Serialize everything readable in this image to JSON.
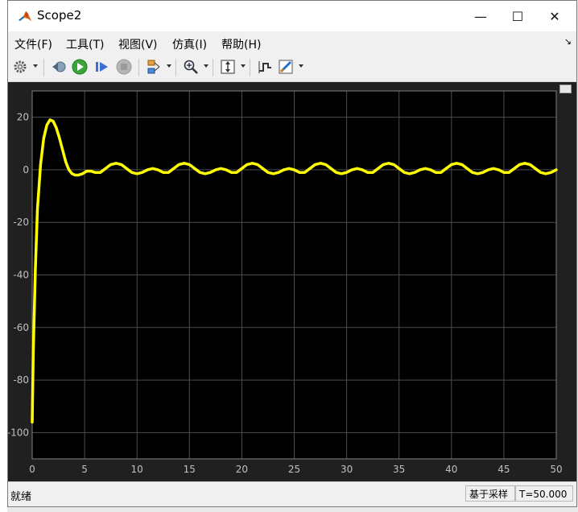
{
  "window": {
    "title": "Scope2",
    "minimize_symbol": "—",
    "maximize_symbol": "☐",
    "close_symbol": "✕"
  },
  "menu": {
    "items": [
      "文件(F)",
      "工具(T)",
      "视图(V)",
      "仿真(I)",
      "帮助(H)"
    ],
    "overflow_symbol": "↘"
  },
  "toolbar": {
    "buttons": [
      {
        "icon": "settings-gear-icon"
      },
      {
        "icon": "step-back-icon"
      },
      {
        "icon": "run-icon"
      },
      {
        "icon": "step-forward-icon"
      },
      {
        "icon": "stop-icon"
      },
      {
        "icon": "signal-selector-icon"
      },
      {
        "icon": "zoom-icon"
      },
      {
        "icon": "scale-axes-icon"
      },
      {
        "icon": "cursor-measure-icon"
      },
      {
        "icon": "style-icon"
      }
    ]
  },
  "status": {
    "left": "就绪",
    "mode": "基于采样",
    "time": "T=50.000"
  },
  "colors": {
    "plot_background": "#000000",
    "figure_background": "#202020",
    "grid": "#4d4d4d",
    "trace": "#ffff00",
    "tick_label": "#c0c0c0"
  },
  "chart_data": {
    "type": "line",
    "title": "",
    "xlabel": "",
    "ylabel": "",
    "xlim": [
      0,
      50
    ],
    "ylim": [
      -110,
      30
    ],
    "grid": true,
    "xticks": [
      0,
      5,
      10,
      15,
      20,
      25,
      30,
      35,
      40,
      45,
      50
    ],
    "yticks": [
      20,
      0,
      -20,
      -40,
      -60,
      -80,
      -100
    ],
    "series": [
      {
        "x": [
          0,
          0.1,
          0.3,
          0.5,
          0.8,
          1.1,
          1.4,
          1.7,
          2.0,
          2.3,
          2.6,
          2.9,
          3.2,
          3.5,
          3.8,
          4.1,
          4.4,
          4.8,
          5.2,
          5.6,
          6.0,
          6.5,
          7.0,
          7.5,
          8.0,
          8.5,
          9.0,
          9.5,
          10.0,
          10.5,
          11.0,
          11.5,
          12.0,
          12.5,
          13.0,
          13.5,
          14.0,
          14.5,
          15.0,
          15.5,
          16.0,
          16.5,
          17.0,
          17.5,
          18.0,
          18.5,
          19.0,
          19.5,
          20.0,
          20.5,
          21.0,
          21.5,
          22.0,
          22.5,
          23.0,
          23.5,
          24.0,
          24.5,
          25.0,
          25.5,
          26.0,
          26.5,
          27.0,
          27.5,
          28.0,
          28.5,
          29.0,
          29.5,
          30.0,
          30.5,
          31.0,
          31.5,
          32.0,
          32.5,
          33.0,
          33.5,
          34.0,
          34.5,
          35.0,
          35.5,
          36.0,
          36.5,
          37.0,
          37.5,
          38.0,
          38.5,
          39.0,
          39.5,
          40.0,
          40.5,
          41.0,
          41.5,
          42.0,
          42.5,
          43.0,
          43.5,
          44.0,
          44.5,
          45.0,
          45.5,
          46.0,
          46.5,
          47.0,
          47.5,
          48.0,
          48.5,
          49.0,
          49.5,
          50.0
        ],
        "y": [
          -96,
          -70,
          -38,
          -15,
          2,
          12,
          17,
          19,
          18.5,
          16,
          12,
          7.5,
          3,
          0,
          -1.5,
          -2,
          -2,
          -1.5,
          -0.5,
          -0.5,
          -1,
          -1,
          0.5,
          2,
          2.5,
          2,
          0.5,
          -1,
          -1.5,
          -1,
          0,
          0.5,
          0,
          -1,
          -1,
          0.5,
          2,
          2.5,
          2,
          0.5,
          -1,
          -1.5,
          -1,
          0,
          0.5,
          0,
          -1,
          -1,
          0.5,
          2,
          2.5,
          2,
          0.5,
          -1,
          -1.5,
          -1,
          0,
          0.5,
          0,
          -1,
          -1,
          0.5,
          2,
          2.5,
          2,
          0.5,
          -1,
          -1.5,
          -1,
          0,
          0.5,
          0,
          -1,
          -1,
          0.5,
          2,
          2.5,
          2,
          0.5,
          -1,
          -1.5,
          -1,
          0,
          0.5,
          0,
          -1,
          -1,
          0.5,
          2,
          2.5,
          2,
          0.5,
          -1,
          -1.5,
          -1,
          0,
          0.5,
          0,
          -1,
          -1,
          0.5,
          2,
          2.5,
          2,
          0.5,
          -1,
          -1.5,
          -1,
          0
        ]
      }
    ]
  }
}
